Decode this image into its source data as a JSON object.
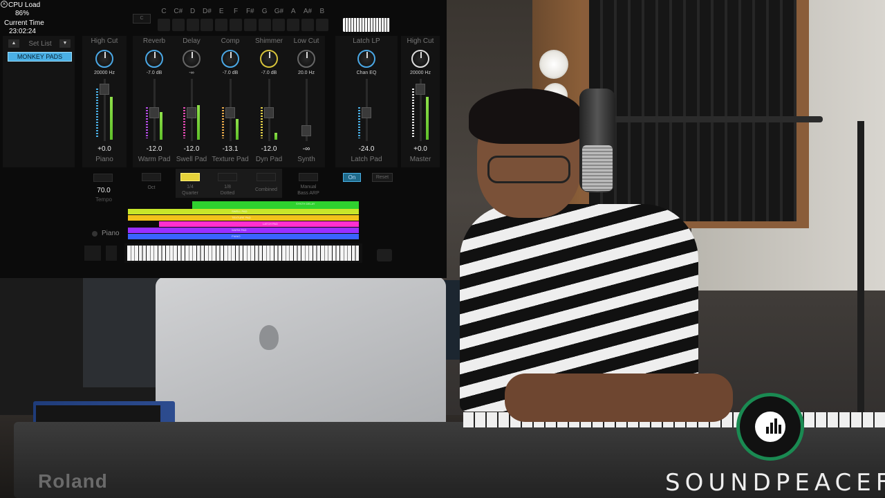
{
  "system": {
    "cpu_label": "CPU Load",
    "cpu_value": "86%",
    "time_label": "Current Time",
    "time_value": "23:02:24"
  },
  "setlist": {
    "header": "Set List",
    "selected": "MONKEY PADS"
  },
  "notes": [
    "C",
    "C#",
    "D",
    "D#",
    "E",
    "F",
    "F#",
    "G",
    "G#",
    "A",
    "A#",
    "B"
  ],
  "channels": [
    {
      "label": "High Cut",
      "value_top": "20000 Hz",
      "value_db": "+0.0",
      "name": "Piano"
    },
    {
      "label": "Reverb",
      "value_top": "-7.0 dB",
      "value_db": "-12.0",
      "name": "Warm Pad"
    },
    {
      "label": "Delay",
      "value_top": "-∞",
      "value_db": "-12.0",
      "name": "Swell Pad"
    },
    {
      "label": "Comp",
      "value_top": "-7.0 dB",
      "value_db": "-13.1",
      "name": "Texture Pad"
    },
    {
      "label": "Shimmer",
      "value_top": "-7.0 dB",
      "value_db": "-12.0",
      "name": "Dyn Pad"
    },
    {
      "label": "Low Cut",
      "value_top": "20.0 Hz",
      "value_db": "-∞",
      "name": "Synth"
    },
    {
      "label": "Latch LP",
      "value_top": "Chan EQ",
      "value_db": "-24.0",
      "name": "Latch Pad"
    },
    {
      "label": "High Cut",
      "value_top": "20000 Hz",
      "value_db": "+0.0",
      "name": "Master"
    }
  ],
  "controls": {
    "tempo_value": "70.0",
    "tempo_label": "Tempo",
    "oct_label": "Oct",
    "quarter_label": "1/4",
    "quarter_sub": "Quarter",
    "dotted_label": "1/8",
    "dotted_sub": "Dotted",
    "combined_label": "Combined",
    "manual_label": "Manual",
    "bassarp_label": "Bass ARP",
    "on_label": "On",
    "reset_label": "Reset",
    "piano_label": "Piano"
  },
  "layers": [
    {
      "name": "SYNTH DELAY",
      "color": "#2fd12f"
    },
    {
      "name": "SWELL PAD",
      "color": "#c8e62a"
    },
    {
      "name": "TEXTURE PAD",
      "color": "#f2c21a"
    },
    {
      "name": "LATCH PAD",
      "color": "#ff2fcf"
    },
    {
      "name": "WARM PAD",
      "color": "#9a2fff"
    },
    {
      "name": "PIANO",
      "color": "#3a63ff"
    }
  ],
  "photo": {
    "brand_text": "SOUNDPEACEFT",
    "keyboard_brand": "Roland"
  }
}
